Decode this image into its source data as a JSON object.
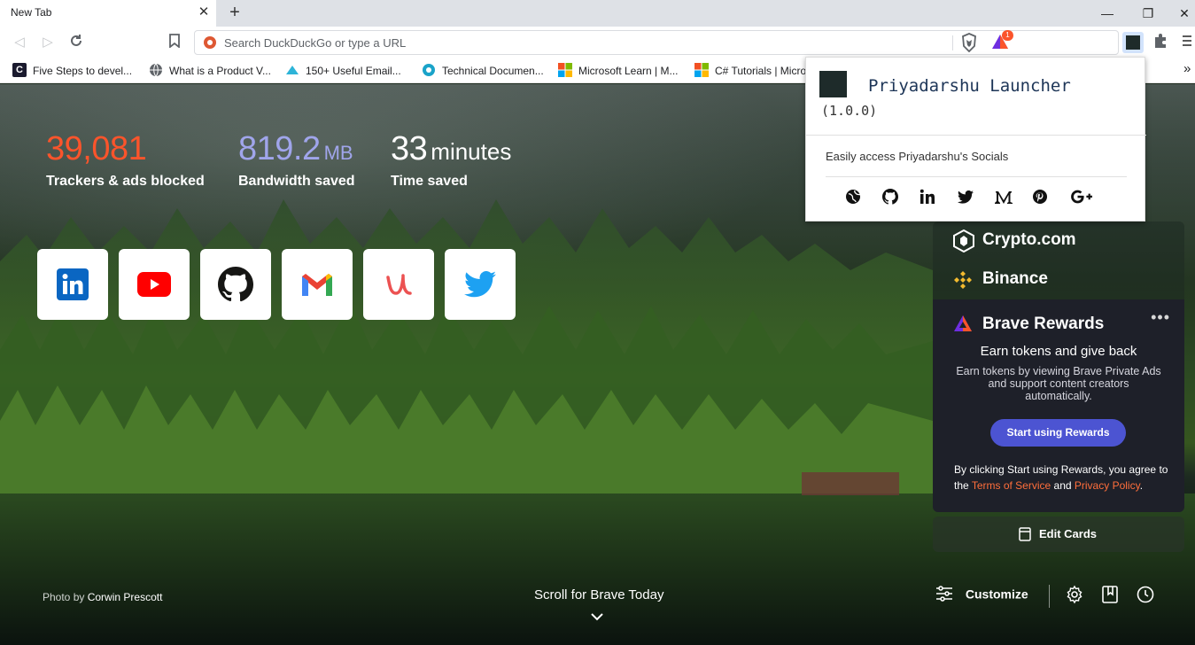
{
  "browser": {
    "tab_title": "New Tab",
    "omnibox_placeholder": "Search DuckDuckGo or type a URL",
    "rewards_badge_count": "1"
  },
  "bookmarks": [
    {
      "label": "Five Steps to devel..."
    },
    {
      "label": "What is a Product V..."
    },
    {
      "label": "150+ Useful Email..."
    },
    {
      "label": "Technical Documen..."
    },
    {
      "label": "Microsoft Learn | M..."
    },
    {
      "label": "C# Tutorials | Micro"
    }
  ],
  "bookmarks_overflow": "»",
  "stats": {
    "trackers": {
      "value": "39,081",
      "label": "Trackers & ads blocked",
      "color": "#fb542b"
    },
    "bandwidth": {
      "value": "819.2",
      "unit": "MB",
      "label": "Bandwidth saved",
      "color": "#a0a5eb"
    },
    "time": {
      "value": "33",
      "unit": "minutes",
      "label": "Time saved",
      "color": "#ffffff"
    }
  },
  "top_sites": [
    "LinkedIn",
    "YouTube",
    "GitHub",
    "Gmail",
    "Udemy",
    "Twitter"
  ],
  "photo_credit": {
    "prefix": "Photo by",
    "author": "Corwin Prescott"
  },
  "scroll_label": "Scroll for Brave Today",
  "customize_label": "Customize",
  "cards": {
    "crypto": "Crypto.com",
    "binance": "Binance",
    "rewards": {
      "title": "Brave Rewards",
      "subtitle": "Earn tokens and give back",
      "description": "Earn tokens by viewing Brave Private Ads and support content creators automatically.",
      "button": "Start using Rewards",
      "legal_prefix": "By clicking Start using Rewards, you agree to the",
      "terms": "Terms of Service",
      "and": "and",
      "privacy": "Privacy Policy",
      "period": "."
    },
    "edit_cards": "Edit Cards"
  },
  "popup": {
    "title": "Priyadarshu Launcher",
    "version": "(1.0.0)",
    "description": "Easily access Priyadarshu's Socials",
    "socials": [
      "website",
      "github",
      "linkedin",
      "twitter",
      "medium",
      "pinterest",
      "google-plus"
    ]
  },
  "colors": {
    "brave_orange": "#fb542b",
    "rewards_button": "#4c54d2",
    "link": "#ff6e3b"
  }
}
